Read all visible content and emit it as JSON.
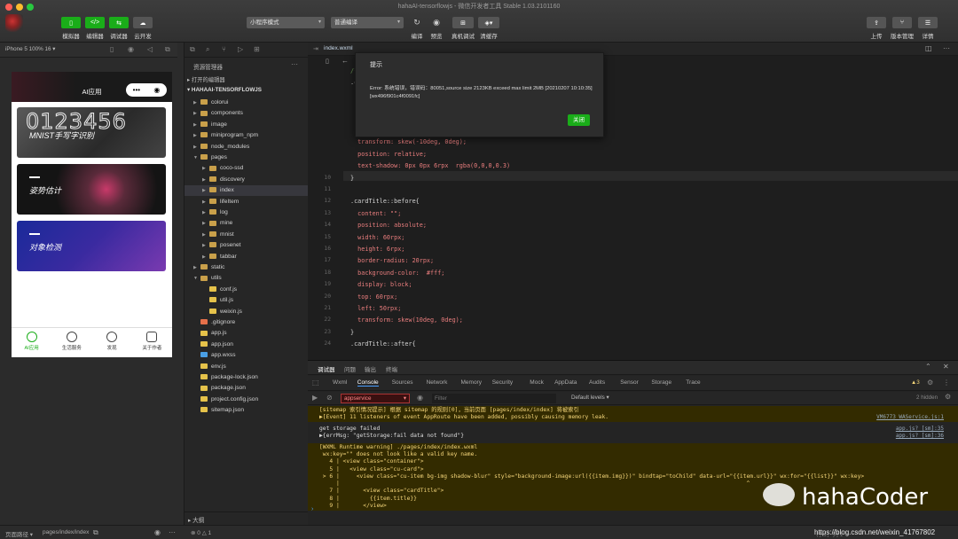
{
  "window_title": "hahaAI-tensorflowjs - 微信开发者工具 Stable 1.03.2101160",
  "toolbar": {
    "simulator_label": "模拟器",
    "editor_label": "编辑器",
    "debugger_label": "调试器",
    "cloud_label": "云开发",
    "mode_select": "小程序模式",
    "compile_select": "普通编译",
    "compile_label": "编译",
    "preview_label": "预览",
    "real_device_label": "真机调试",
    "clear_cache_label": "清缓存",
    "upload_label": "上传",
    "version_label": "版本管理",
    "details_label": "详情"
  },
  "simulator": {
    "device": "iPhone 5 100% 16 ▾",
    "app_title": "AI应用",
    "cards": [
      {
        "title": "MNIST手写字识别",
        "art": "0123456"
      },
      {
        "title": "姿势估计"
      },
      {
        "title": "对象检测"
      }
    ],
    "tabs": [
      "AI应用",
      "生活服务",
      "发现",
      "关于作者"
    ]
  },
  "explorer": {
    "title": "资源管理器",
    "open_editors": "打开的编辑器",
    "project": "HAHAAI-TENSORFLOWJS",
    "tree": [
      {
        "name": "colorui",
        "level": 1,
        "type": "folder",
        "arrow": "▶"
      },
      {
        "name": "components",
        "level": 1,
        "type": "folder",
        "arrow": "▶"
      },
      {
        "name": "image",
        "level": 1,
        "type": "folder",
        "arrow": "▶"
      },
      {
        "name": "miniprogram_npm",
        "level": 1,
        "type": "folder",
        "arrow": "▶"
      },
      {
        "name": "node_modules",
        "level": 1,
        "type": "folder",
        "arrow": "▶"
      },
      {
        "name": "pages",
        "level": 1,
        "type": "folder",
        "arrow": "▼"
      },
      {
        "name": "coco-ssd",
        "level": 2,
        "type": "folder",
        "arrow": "▶"
      },
      {
        "name": "discovery",
        "level": 2,
        "type": "folder",
        "arrow": "▶"
      },
      {
        "name": "index",
        "level": 2,
        "type": "folder",
        "arrow": "▶"
      },
      {
        "name": "lifeItem",
        "level": 2,
        "type": "folder",
        "arrow": "▶"
      },
      {
        "name": "log",
        "level": 2,
        "type": "folder",
        "arrow": "▶"
      },
      {
        "name": "mine",
        "level": 2,
        "type": "folder",
        "arrow": "▶"
      },
      {
        "name": "mnist",
        "level": 2,
        "type": "folder",
        "arrow": "▶"
      },
      {
        "name": "posenet",
        "level": 2,
        "type": "folder",
        "arrow": "▶"
      },
      {
        "name": "tabbar",
        "level": 2,
        "type": "folder",
        "arrow": "▶"
      },
      {
        "name": "static",
        "level": 1,
        "type": "folder",
        "arrow": "▶"
      },
      {
        "name": "utils",
        "level": 1,
        "type": "folder",
        "arrow": "▼"
      },
      {
        "name": "conf.js",
        "level": 2,
        "type": "js",
        "arrow": ""
      },
      {
        "name": "util.js",
        "level": 2,
        "type": "js",
        "arrow": ""
      },
      {
        "name": "weixin.js",
        "level": 2,
        "type": "js",
        "arrow": ""
      },
      {
        "name": ".gitignore",
        "level": 1,
        "type": "git",
        "arrow": ""
      },
      {
        "name": "app.js",
        "level": 1,
        "type": "js",
        "arrow": ""
      },
      {
        "name": "app.json",
        "level": 1,
        "type": "json",
        "arrow": ""
      },
      {
        "name": "app.wxss",
        "level": 1,
        "type": "wxss",
        "arrow": ""
      },
      {
        "name": "env.js",
        "level": 1,
        "type": "js",
        "arrow": ""
      },
      {
        "name": "package-lock.json",
        "level": 1,
        "type": "json",
        "arrow": ""
      },
      {
        "name": "package.json",
        "level": 1,
        "type": "json",
        "arrow": ""
      },
      {
        "name": "project.config.json",
        "level": 1,
        "type": "json",
        "arrow": ""
      },
      {
        "name": "sitemap.json",
        "level": 1,
        "type": "json",
        "arrow": ""
      }
    ],
    "outline": "大纲"
  },
  "editor": {
    "tab": "index.wxml",
    "lines": [
      {
        "n": "",
        "t": "/*"
      },
      {
        "n": "",
        "t": ".ca"
      },
      {
        "n": "",
        "t": "  c"
      },
      {
        "n": "",
        "t": "  p"
      },
      {
        "n": "",
        "t": "  f"
      },
      {
        "n": "",
        "t": "  f"
      },
      {
        "n": "",
        "t": "  transform: skew(-10deg, 0deg);"
      },
      {
        "n": "",
        "t": "  position: relative;"
      },
      {
        "n": "",
        "t": "  text-shadow: 0px 0px 6rpx  rgba(0,0,0,0.3)"
      },
      {
        "n": "10",
        "t": "}"
      },
      {
        "n": "11",
        "t": ""
      },
      {
        "n": "12",
        "t": ".cardTitle::before{"
      },
      {
        "n": "13",
        "t": "  content: \"\";"
      },
      {
        "n": "14",
        "t": "  position: absolute;"
      },
      {
        "n": "15",
        "t": "  width: 60rpx;"
      },
      {
        "n": "16",
        "t": "  height: 6rpx;"
      },
      {
        "n": "17",
        "t": "  border-radius: 20rpx;"
      },
      {
        "n": "18",
        "t": "  background-color:  #fff;"
      },
      {
        "n": "19",
        "t": "  display: block;"
      },
      {
        "n": "20",
        "t": "  top: 60rpx;"
      },
      {
        "n": "21",
        "t": "  left: 50rpx;"
      },
      {
        "n": "22",
        "t": "  transform: skew(10deg, 0deg);"
      },
      {
        "n": "23",
        "t": "}"
      },
      {
        "n": "24",
        "t": ".cardTitle::after{"
      }
    ]
  },
  "modal": {
    "title": "提示",
    "message": "Error: 系统错误，错误码：80051,source size 2123KB exceed max limit 2MB [20210207 10:10:35][wx496f901c4f0091fc]",
    "close_label": "关闭"
  },
  "console": {
    "top_tabs": [
      "调试器",
      "问题",
      "输出",
      "终端"
    ],
    "tabs": [
      "Wxml",
      "Console",
      "Sources",
      "Network",
      "Memory",
      "Security",
      "Mock",
      "AppData",
      "Audits",
      "Sensor",
      "Storage",
      "Trace"
    ],
    "active_tab": "Console",
    "context": "appservice",
    "filter_placeholder": "Filter",
    "levels": "Default levels ▾",
    "warnings_count": "3",
    "hidden_count": "2 hidden",
    "messages": [
      {
        "kind": "warn",
        "text": "[sitemap 索引情况提示] 根据 sitemap 的规则[0]，当前页面 [pages/index/index] 将被索引",
        "src": ""
      },
      {
        "kind": "warn",
        "text": "▶[Event] 11 listeners of event AppRoute have been added, possibly causing memory leak.",
        "src": "VM6773 WAService.js:1"
      },
      {
        "kind": "log",
        "text": "get storage failed",
        "src": "app.js? [sm]:35"
      },
      {
        "kind": "log",
        "text": "▶{errMsg: \"getStorage:fail data not found\"}",
        "src": "app.js? [sm]:36"
      },
      {
        "kind": "warn",
        "text": "[WXML Runtime warning] ./pages/index/index.wxml",
        "src": ""
      },
      {
        "kind": "warn",
        "text": " wx:key=\"\" does not look like a valid key name.",
        "src": ""
      },
      {
        "kind": "warn",
        "text": "   4 | <view class=\"container\">",
        "src": ""
      },
      {
        "kind": "warn",
        "text": "   5 |   <view class=\"cu-card\">",
        "src": ""
      },
      {
        "kind": "warn",
        "text": " > 6 |     <view class=\"cu-item bg-img shadow-blur\" style=\"background-image:url({{item.img}})\" bindtap=\"toChild\" data-url=\"{{item.url}}\" wx:for=\"{{list}}\" wx:key>",
        "src": ""
      },
      {
        "kind": "warn",
        "text": "     |                                                                                                                         ^",
        "src": ""
      },
      {
        "kind": "warn",
        "text": "   7 |       <view class=\"cardTitle\">",
        "src": ""
      },
      {
        "kind": "warn",
        "text": "   8 |         {{item.title}}",
        "src": ""
      },
      {
        "kind": "warn",
        "text": "   9 |       </view>",
        "src": ""
      }
    ]
  },
  "status": {
    "page_path_label": "页面路径 ▾",
    "page_path": "pages/index/index",
    "errors": "0",
    "warnings": "1",
    "right": "行 1，列 1"
  },
  "watermark": {
    "brand": "hahaCoder",
    "url": "https://blog.csdn.net/weixin_41767802"
  },
  "colors": {
    "accent_green": "#1aad19",
    "warning_bg": "#332b00",
    "background": "#2b2b2b"
  }
}
